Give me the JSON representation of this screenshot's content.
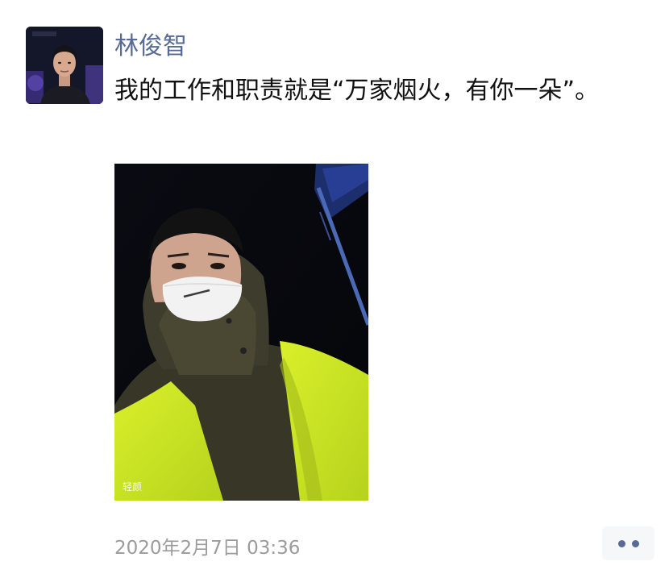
{
  "post": {
    "author": "林俊智",
    "text": "我的工作和职责就是“万家烟火，有你一朵”。",
    "photo_watermark": "轻颜",
    "timestamp": "2020年2月7日 03:36"
  },
  "icons": {
    "more": "more-dots-icon"
  },
  "colors": {
    "author_name": "#576b95",
    "text": "#111111",
    "timestamp": "#9b9b9b",
    "more_button_bg": "#f6f7f9"
  }
}
